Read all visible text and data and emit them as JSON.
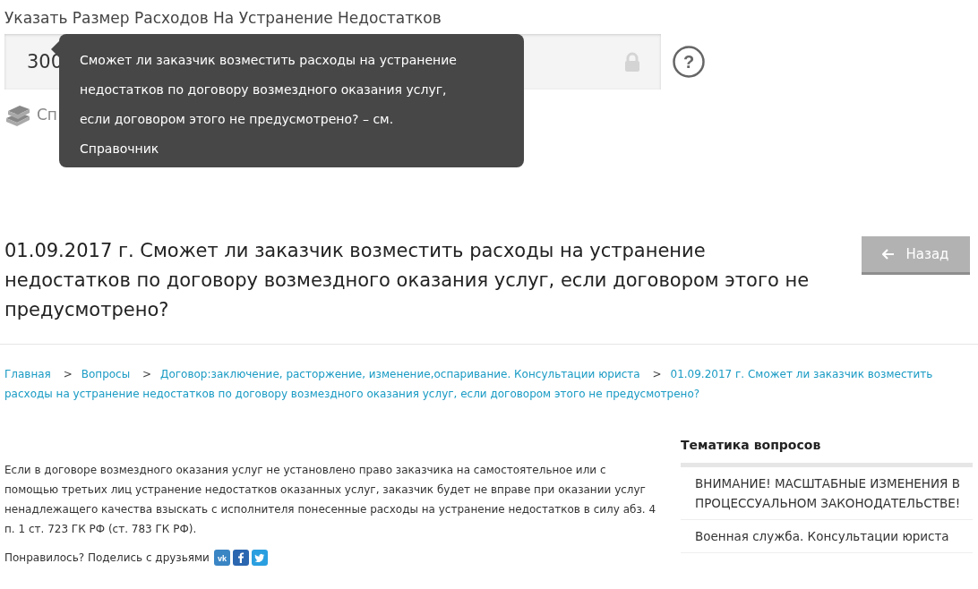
{
  "field": {
    "label": "Указать Размер Расходов На Устранение Недостатков",
    "value": "300",
    "locked": true
  },
  "help_icon": "?",
  "reference_link": "Сп",
  "tooltip": {
    "lines": [
      "Сможет ли заказчик возместить расходы на устранение",
      "недостатков по договору возмездного оказания услуг,",
      "если договором этого не предусмотрено? – см.",
      "Справочник"
    ]
  },
  "heading": "01.09.2017 г. Сможет ли заказчик возместить расходы на устранение недостатков по договору возмездного оказания услуг, если договором этого не предусмотрено?",
  "back_button": "Назад",
  "breadcrumbs": [
    {
      "label": "Главная"
    },
    {
      "label": "Вопросы"
    },
    {
      "label": "Договор:заключение, расторжение, изменение,оспаривание. Консультации юриста"
    },
    {
      "label": "01.09.2017 г. Сможет ли заказчик возместить расходы на устранение недостатков по договору возмездного оказания услуг, если договором этого не предусмотрено?"
    }
  ],
  "breadcrumb_separator": ">",
  "answer": "Если в договоре возмездного оказания услуг не установлено право заказчика на самостоятельное или с помощью третьих лиц устранение недостатков оказанных услуг, заказчик будет не вправе при оказании услуг ненадлежащего качества взыскать с исполнителя понесенные расходы на устранение недостатков в силу абз. 4 п. 1 ст. 723 ГК РФ (ст. 783 ГК РФ).",
  "share": {
    "label": "Понравилось? Поделись с друзьями",
    "networks": [
      {
        "kind": "vk"
      },
      {
        "kind": "facebook"
      },
      {
        "kind": "twitter"
      }
    ]
  },
  "sidebar": {
    "title": "Тематика вопросов",
    "items": [
      {
        "label": "ВНИМАНИЕ! МАСШТАБНЫЕ ИЗМЕНЕНИЯ В ПРОЦЕССУАЛЬНОМ ЗАКОНОДАТЕЛЬСТВЕ!"
      },
      {
        "label": "Военная служба. Консультации юриста"
      }
    ]
  }
}
